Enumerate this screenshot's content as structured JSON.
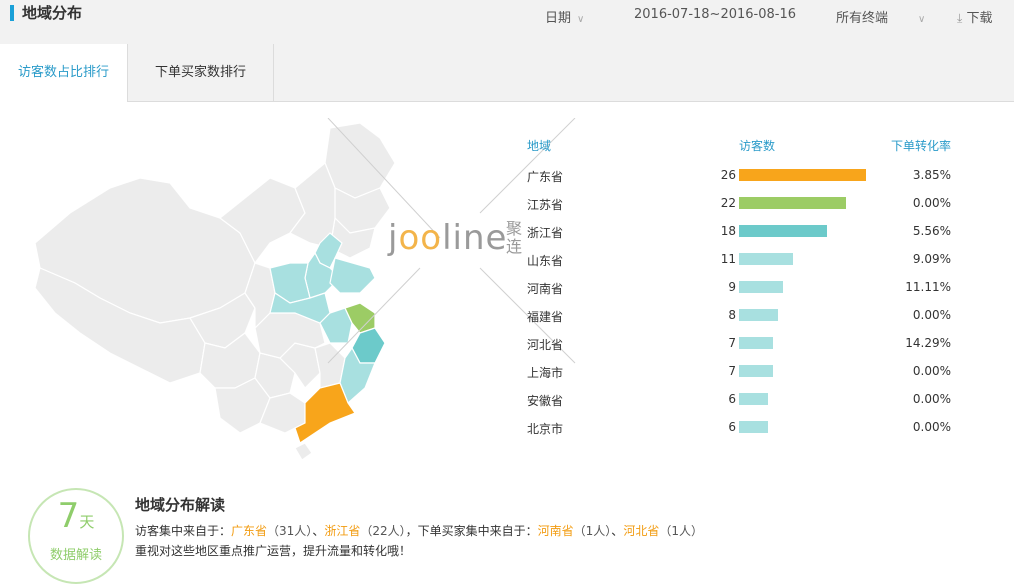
{
  "header": {
    "title": "地域分布",
    "date_label": "日期",
    "date_range": "2016-07-18~2016-08-16",
    "terminal_label": "所有终端",
    "download_label": "下载"
  },
  "tabs": [
    {
      "label": "访客数占比排行",
      "active": true
    },
    {
      "label": "下单买家数排行",
      "active": false
    }
  ],
  "watermark": {
    "text_prefix": "j",
    "text_oo": "oo",
    "text_suffix": "line",
    "cn": "聚连"
  },
  "table": {
    "headers": {
      "region": "地域",
      "visitors": "访客数",
      "conversion": "下单转化率"
    },
    "max_visitors": 26,
    "rows": [
      {
        "region": "广东省",
        "visitors": "26",
        "value": 26,
        "rate": "3.85%",
        "color": "#f8a51b"
      },
      {
        "region": "江苏省",
        "visitors": "22",
        "value": 22,
        "rate": "0.00%",
        "color": "#9ccc65"
      },
      {
        "region": "浙江省",
        "visitors": "18",
        "value": 18,
        "rate": "5.56%",
        "color": "#6ccaca"
      },
      {
        "region": "山东省",
        "visitors": "11",
        "value": 11,
        "rate": "9.09%",
        "color": "#a8e0e0"
      },
      {
        "region": "河南省",
        "visitors": "9",
        "value": 9,
        "rate": "11.11%",
        "color": "#a8e0e0"
      },
      {
        "region": "福建省",
        "visitors": "8",
        "value": 8,
        "rate": "0.00%",
        "color": "#a8e0e0"
      },
      {
        "region": "河北省",
        "visitors": "7",
        "value": 7,
        "rate": "14.29%",
        "color": "#a8e0e0"
      },
      {
        "region": "上海市",
        "visitors": "7",
        "value": 7,
        "rate": "0.00%",
        "color": "#a8e0e0"
      },
      {
        "region": "安徽省",
        "visitors": "6",
        "value": 6,
        "rate": "0.00%",
        "color": "#a8e0e0"
      },
      {
        "region": "北京市",
        "visitors": "6",
        "value": 6,
        "rate": "0.00%",
        "color": "#a8e0e0"
      }
    ]
  },
  "insight": {
    "badge_number": "7",
    "badge_unit": "天",
    "badge_label": "数据解读",
    "title": "地域分布解读",
    "line1_prefix": "访客集中来自于：",
    "v_region1": "广东省",
    "v_count1": "（31人）",
    "sep": "、",
    "v_region2": "浙江省",
    "v_count2": "（22人）",
    "buyers_prefix": "，下单买家集中来自于：",
    "b_region1": "河南省",
    "b_count1": "（1人）",
    "b_region2": "河北省",
    "b_count2": "（1人）",
    "line2": "重视对这些地区重点推广运营，提升流量和转化哦！"
  },
  "colors": {
    "accent": "#2a9bc9",
    "highlight": "#f29c12",
    "badge": "#8fcd6b"
  }
}
